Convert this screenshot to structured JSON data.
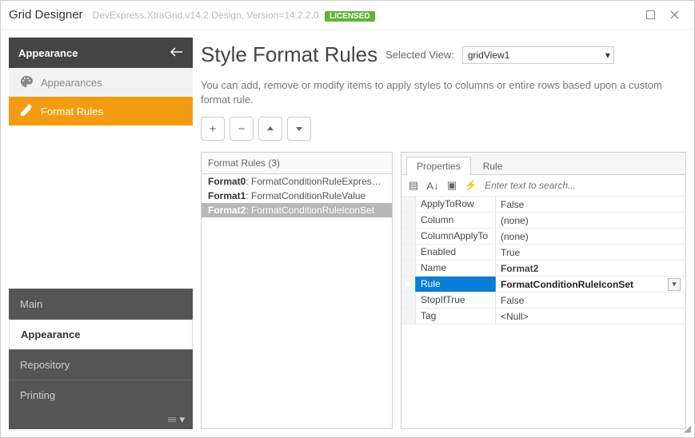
{
  "window": {
    "title": "Grid Designer",
    "subtitle": "DevExpress.XtraGrid.v14.2.Design, Version=14.2.2.0",
    "license_badge": "LICENSED"
  },
  "sidebar": {
    "header": "Appearance",
    "items": [
      {
        "label": "Appearances",
        "icon": "palette-icon"
      },
      {
        "label": "Format Rules",
        "icon": "edit-icon"
      }
    ],
    "nav": [
      {
        "label": "Main"
      },
      {
        "label": "Appearance"
      },
      {
        "label": "Repository"
      },
      {
        "label": "Printing"
      }
    ]
  },
  "main": {
    "heading": "Style Format Rules",
    "selected_view_label": "Selected View:",
    "selected_view_value": "gridView1",
    "description": "You can add, remove or modify items to apply styles to columns or entire rows based upon a custom format rule."
  },
  "format_rules": {
    "title": "Format Rules (3)",
    "items": [
      {
        "name": "Format0",
        "type": "FormatConditionRuleExpression"
      },
      {
        "name": "Format1",
        "type": "FormatConditionRuleValue"
      },
      {
        "name": "Format2",
        "type": "FormatConditionRuleIconSet"
      }
    ]
  },
  "properties": {
    "tabs": [
      "Properties",
      "Rule"
    ],
    "search_placeholder": "Enter text to search...",
    "rows": [
      {
        "name": "ApplyToRow",
        "value": "False"
      },
      {
        "name": "Column",
        "value": "(none)"
      },
      {
        "name": "ColumnApplyTo",
        "value": "(none)"
      },
      {
        "name": "Enabled",
        "value": "True"
      },
      {
        "name": "Name",
        "value": "Format2"
      },
      {
        "name": "Rule",
        "value": "FormatConditionRuleIconSet"
      },
      {
        "name": "StopIfTrue",
        "value": "False"
      },
      {
        "name": "Tag",
        "value": "<Null>"
      }
    ]
  }
}
